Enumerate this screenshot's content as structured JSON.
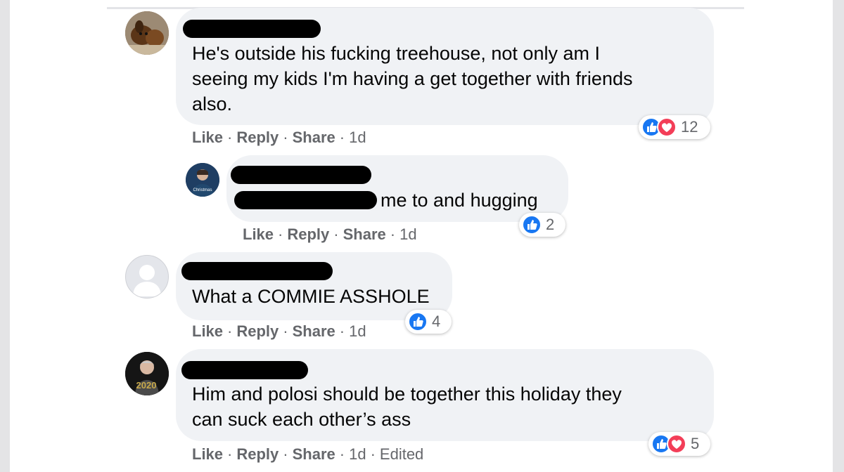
{
  "comments": [
    {
      "text_lines": [
        "He's outside his fucking treehouse, not only am I",
        "seeing my kids I'm having a get together with friends",
        "also."
      ],
      "actions": {
        "like": "Like",
        "reply": "Reply",
        "share": "Share",
        "time": "1d"
      },
      "reactions": {
        "types": [
          "like",
          "love"
        ],
        "count": "12"
      }
    },
    {
      "text": "me to and hugging",
      "actions": {
        "like": "Like",
        "reply": "Reply",
        "share": "Share",
        "time": "1d"
      },
      "reactions": {
        "types": [
          "like"
        ],
        "count": "2"
      }
    },
    {
      "text": "What a COMMIE ASSHOLE",
      "actions": {
        "like": "Like",
        "reply": "Reply",
        "share": "Share",
        "time": "1d"
      },
      "reactions": {
        "types": [
          "like"
        ],
        "count": "4"
      }
    },
    {
      "text_lines": [
        "Him and polosi should be together this holiday they",
        "can suck each other’s ass"
      ],
      "actions": {
        "like": "Like",
        "reply": "Reply",
        "share": "Share",
        "time": "1d",
        "edited": "Edited"
      },
      "reactions": {
        "types": [
          "like",
          "love"
        ],
        "count": "5"
      }
    }
  ],
  "colors": {
    "like": "#1877f2",
    "love": "#f33e58",
    "bubble": "#f0f2f5",
    "meta": "#65676b"
  }
}
